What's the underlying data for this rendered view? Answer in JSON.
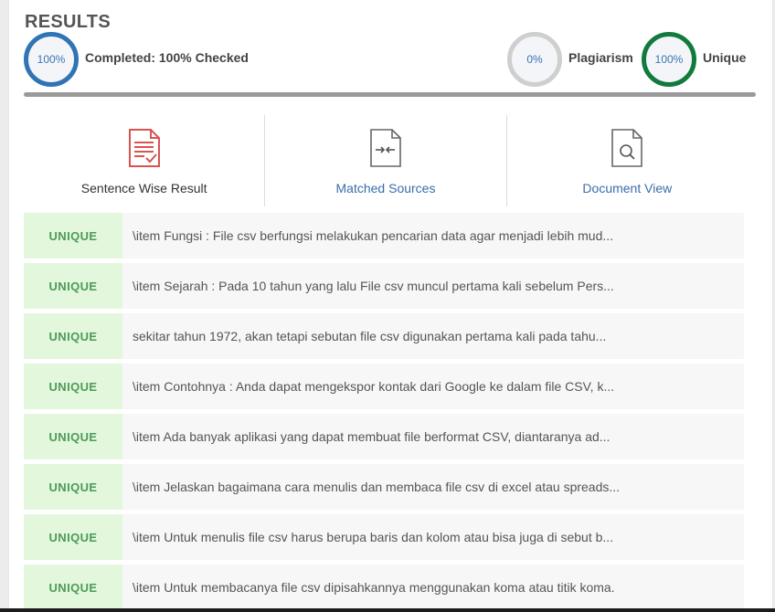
{
  "header": {
    "title": "RESULTS"
  },
  "stats": {
    "completed": {
      "circle_text": "100%",
      "label": "Completed: 100% Checked",
      "color": "#2f74b5"
    },
    "plagiarism": {
      "circle_text": "0%",
      "label": "Plagiarism",
      "color": "#cfcfcf"
    },
    "unique": {
      "circle_text": "100%",
      "label": "Unique",
      "color": "#117a3d"
    }
  },
  "tabs": [
    {
      "label": "Sentence Wise Result",
      "icon": "document-check-icon",
      "active": true
    },
    {
      "label": "Matched Sources",
      "icon": "document-compare-icon",
      "active": false
    },
    {
      "label": "Document View",
      "icon": "document-search-icon",
      "active": false
    }
  ],
  "results": [
    {
      "status": "UNIQUE",
      "text": "\\item Fungsi : File csv berfungsi melakukan pencarian data agar menjadi lebih mud..."
    },
    {
      "status": "UNIQUE",
      "text": "\\item Sejarah : Pada 10 tahun yang lalu File csv muncul pertama kali sebelum Pers..."
    },
    {
      "status": "UNIQUE",
      "text": "sekitar tahun 1972, akan tetapi sebutan file csv digunakan pertama kali pada tahu..."
    },
    {
      "status": "UNIQUE",
      "text": "\\item Contohnya : Anda dapat mengekspor kontak dari Google ke dalam file CSV, k..."
    },
    {
      "status": "UNIQUE",
      "text": "\\item Ada banyak aplikasi yang dapat membuat file berformat CSV, diantaranya ad..."
    },
    {
      "status": "UNIQUE",
      "text": "\\item Jelaskan bagaimana cara menulis dan membaca file csv di excel atau spreads..."
    },
    {
      "status": "UNIQUE",
      "text": "\\item Untuk menulis file csv harus berupa baris dan kolom atau bisa juga di sebut b..."
    },
    {
      "status": "UNIQUE",
      "text": "\\item Untuk membacanya file csv dipisahkannya menggunakan koma atau titik koma."
    }
  ],
  "colors": {
    "unique_badge_bg": "#e3f7dc",
    "unique_badge_text": "#4d9a59",
    "link": "#3a6da8"
  }
}
